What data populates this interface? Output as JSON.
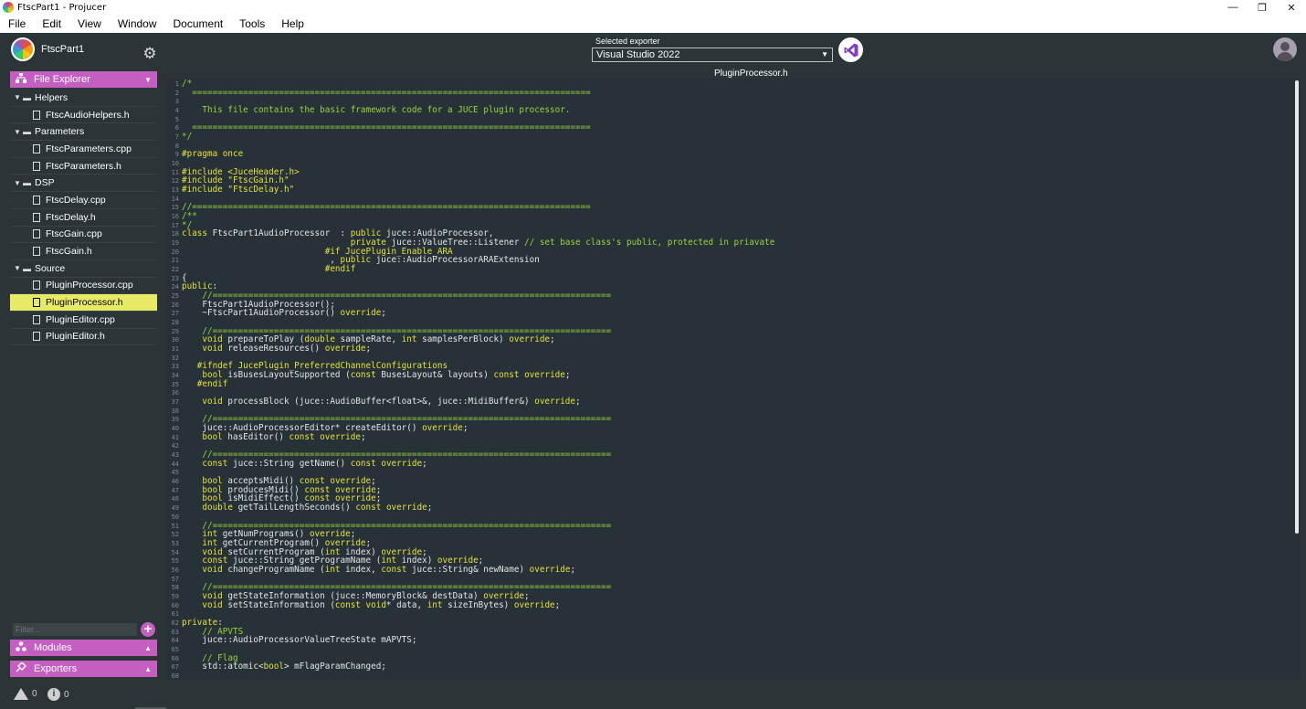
{
  "window": {
    "title": "FtscPart1 - Projucer",
    "controls": [
      "—",
      "❐",
      "✕"
    ]
  },
  "menu": [
    "File",
    "Edit",
    "View",
    "Window",
    "Document",
    "Tools",
    "Help"
  ],
  "project": {
    "name": "FtscPart1"
  },
  "exporter": {
    "label": "Selected exporter",
    "value": "Visual Studio 2022"
  },
  "sidebar": {
    "file_explorer_label": "File Explorer",
    "tree": [
      {
        "type": "group",
        "label": "Helpers"
      },
      {
        "type": "file",
        "label": "FtscAudioHelpers.h"
      },
      {
        "type": "group",
        "label": "Parameters"
      },
      {
        "type": "file",
        "label": "FtscParameters.cpp"
      },
      {
        "type": "file",
        "label": "FtscParameters.h"
      },
      {
        "type": "group",
        "label": "DSP"
      },
      {
        "type": "file",
        "label": "FtscDelay.cpp"
      },
      {
        "type": "file",
        "label": "FtscDelay.h"
      },
      {
        "type": "file",
        "label": "FtscGain.cpp"
      },
      {
        "type": "file",
        "label": "FtscGain.h"
      },
      {
        "type": "group",
        "label": "Source"
      },
      {
        "type": "file",
        "label": "PluginProcessor.cpp"
      },
      {
        "type": "file",
        "label": "PluginProcessor.h",
        "selected": true
      },
      {
        "type": "file",
        "label": "PluginEditor.cpp"
      },
      {
        "type": "file",
        "label": "PluginEditor.h"
      }
    ],
    "filter_placeholder": "Filter...",
    "modules_label": "Modules",
    "exporters_label": "Exporters"
  },
  "status": {
    "warnings": "0",
    "infos": "0"
  },
  "editor": {
    "filename": "PluginProcessor.h",
    "colors": {
      "keyword": "#e8e03a",
      "comment": "#9bd33c",
      "preprocessor": "#e8e03a",
      "text": "#e5e5e5",
      "string": "#e8e03a",
      "type": "#e8e03a"
    },
    "lines": [
      "/*",
      "  ==============================================================================",
      "",
      "    This file contains the basic framework code for a JUCE plugin processor.",
      "",
      "  ==============================================================================",
      "*/",
      "",
      "#pragma once",
      "",
      "#include <JuceHeader.h>",
      "#include \"FtscGain.h\"",
      "#include \"FtscDelay.h\"",
      "",
      "//==============================================================================",
      "/**",
      "*/",
      "class FtscPart1AudioProcessor  : public juce::AudioProcessor,",
      "                                 private juce::ValueTree::Listener // set base class's public, protected in priavate",
      "                            #if JucePlugin_Enable_ARA",
      "                             , public juce::AudioProcessorARAExtension",
      "                            #endif",
      "{",
      "public:",
      "    //==============================================================================",
      "    FtscPart1AudioProcessor();",
      "    ~FtscPart1AudioProcessor() override;",
      "",
      "    //==============================================================================",
      "    void prepareToPlay (double sampleRate, int samplesPerBlock) override;",
      "    void releaseResources() override;",
      "",
      "   #ifndef JucePlugin_PreferredChannelConfigurations",
      "    bool isBusesLayoutSupported (const BusesLayout& layouts) const override;",
      "   #endif",
      "",
      "    void processBlock (juce::AudioBuffer<float>&, juce::MidiBuffer&) override;",
      "",
      "    //==============================================================================",
      "    juce::AudioProcessorEditor* createEditor() override;",
      "    bool hasEditor() const override;",
      "",
      "    //==============================================================================",
      "    const juce::String getName() const override;",
      "",
      "    bool acceptsMidi() const override;",
      "    bool producesMidi() const override;",
      "    bool isMidiEffect() const override;",
      "    double getTailLengthSeconds() const override;",
      "",
      "    //==============================================================================",
      "    int getNumPrograms() override;",
      "    int getCurrentProgram() override;",
      "    void setCurrentProgram (int index) override;",
      "    const juce::String getProgramName (int index) override;",
      "    void changeProgramName (int index, const juce::String& newName) override;",
      "",
      "    //==============================================================================",
      "    void getStateInformation (juce::MemoryBlock& destData) override;",
      "    void setStateInformation (const void* data, int sizeInBytes) override;",
      "",
      "private:",
      "    // APVTS",
      "    juce::AudioProcessorValueTreeState mAPVTS;",
      "",
      "    // Flag",
      "    std::atomic<bool> mFlagParamChanged;",
      ""
    ]
  }
}
